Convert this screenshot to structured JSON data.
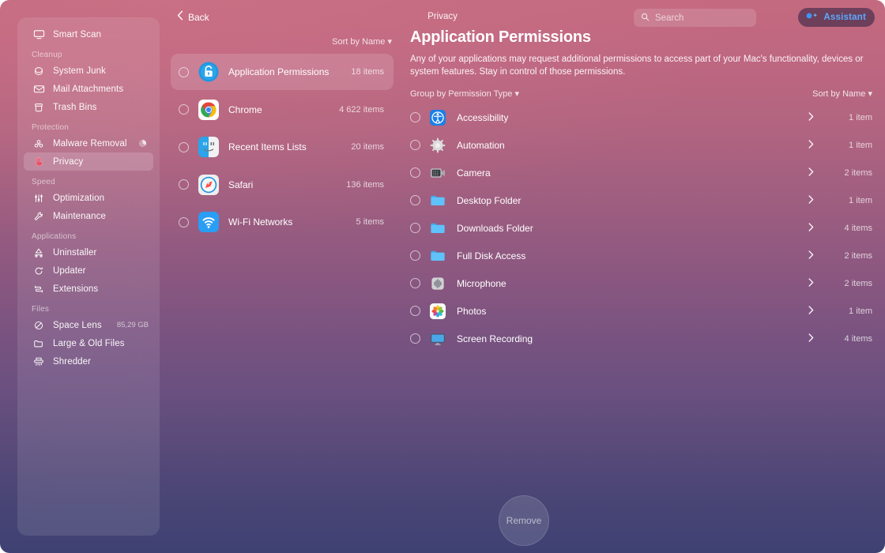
{
  "window": {
    "title": "Privacy",
    "back_label": "Back"
  },
  "search": {
    "placeholder": "Search",
    "value": "",
    "icon": "search-icon"
  },
  "assistant": {
    "label": "Assistant",
    "icon": "sparkle-dot-icon",
    "accent": "#5aa9ff"
  },
  "sidebar": {
    "items": [
      {
        "label": "Smart Scan",
        "icon": "smart-scan-icon",
        "type": "item"
      },
      {
        "label": "Cleanup",
        "type": "section"
      },
      {
        "label": "System Junk",
        "icon": "system-junk-icon",
        "type": "item"
      },
      {
        "label": "Mail Attachments",
        "icon": "mail-icon",
        "type": "item"
      },
      {
        "label": "Trash Bins",
        "icon": "trash-icon",
        "type": "item"
      },
      {
        "label": "Protection",
        "type": "section"
      },
      {
        "label": "Malware Removal",
        "icon": "biohazard-icon",
        "type": "item",
        "badge": "pie-badge-icon"
      },
      {
        "label": "Privacy",
        "icon": "privacy-hand-icon",
        "type": "item",
        "selected": true
      },
      {
        "label": "Speed",
        "type": "section"
      },
      {
        "label": "Optimization",
        "icon": "sliders-icon",
        "type": "item"
      },
      {
        "label": "Maintenance",
        "icon": "wrench-icon",
        "type": "item"
      },
      {
        "label": "Applications",
        "type": "section"
      },
      {
        "label": "Uninstaller",
        "icon": "uninstaller-icon",
        "type": "item"
      },
      {
        "label": "Updater",
        "icon": "updater-icon",
        "type": "item"
      },
      {
        "label": "Extensions",
        "icon": "extensions-icon",
        "type": "item"
      },
      {
        "label": "Files",
        "type": "section"
      },
      {
        "label": "Space Lens",
        "icon": "space-lens-icon",
        "type": "item",
        "trailing": "85,29 GB"
      },
      {
        "label": "Large & Old Files",
        "icon": "folder-icon",
        "type": "item"
      },
      {
        "label": "Shredder",
        "icon": "shredder-icon",
        "type": "item"
      }
    ]
  },
  "middle": {
    "sort_label": "Sort by Name",
    "items": [
      {
        "name": "Application Permissions",
        "count": "18 items",
        "icon": "unlock-circle-icon",
        "selected": true
      },
      {
        "name": "Chrome",
        "count": "4 622 items",
        "icon": "chrome-icon",
        "selected": false
      },
      {
        "name": "Recent Items Lists",
        "count": "20 items",
        "icon": "finder-icon",
        "selected": false
      },
      {
        "name": "Safari",
        "count": "136 items",
        "icon": "safari-icon",
        "selected": false
      },
      {
        "name": "Wi-Fi Networks",
        "count": "5 items",
        "icon": "wifi-icon",
        "selected": false
      }
    ]
  },
  "main": {
    "title": "Application Permissions",
    "description": "Any of your applications may request additional permissions to access part of your Mac's functionality, devices or system features. Stay in control of those permissions.",
    "group_label": "Group by Permission Type",
    "sort_label": "Sort by Name",
    "permissions": [
      {
        "name": "Accessibility",
        "count": "1 item",
        "icon": "accessibility-icon"
      },
      {
        "name": "Automation",
        "count": "1 item",
        "icon": "gear-icon"
      },
      {
        "name": "Camera",
        "count": "2 items",
        "icon": "camera-icon"
      },
      {
        "name": "Desktop Folder",
        "count": "1 item",
        "icon": "folder-blue-icon"
      },
      {
        "name": "Downloads Folder",
        "count": "4 items",
        "icon": "folder-blue-icon"
      },
      {
        "name": "Full Disk Access",
        "count": "2 items",
        "icon": "folder-blue-icon"
      },
      {
        "name": "Microphone",
        "count": "2 items",
        "icon": "microphone-icon"
      },
      {
        "name": "Photos",
        "count": "1 item",
        "icon": "photos-icon"
      },
      {
        "name": "Screen Recording",
        "count": "4 items",
        "icon": "display-icon"
      }
    ]
  },
  "footer": {
    "remove_label": "Remove"
  }
}
